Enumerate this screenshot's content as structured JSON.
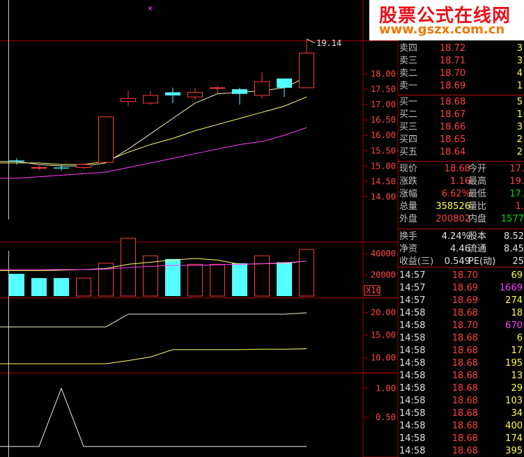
{
  "logo": {
    "line1": "股票公式在线网",
    "line2": "www.gszx.com.cn"
  },
  "price_chart": {
    "high_marker": "19.14",
    "y_ticks": [
      "18.00",
      "17.50",
      "17.00",
      "16.50",
      "16.00",
      "15.50",
      "15.00",
      "14.50",
      "14.00"
    ],
    "ylim": [
      13.6,
      19.5
    ],
    "candles": [
      {
        "o": 15.15,
        "c": 15.18,
        "h": 15.25,
        "l": 15.05,
        "up": false
      },
      {
        "o": 14.95,
        "c": 14.95,
        "h": 15.05,
        "l": 14.85,
        "up": true
      },
      {
        "o": 14.92,
        "c": 14.95,
        "h": 15.05,
        "l": 14.85,
        "up": false
      },
      {
        "o": 14.95,
        "c": 15.05,
        "h": 15.1,
        "l": 14.9,
        "up": true
      },
      {
        "o": 15.12,
        "c": 16.6,
        "h": 16.6,
        "l": 15.12,
        "up": true
      },
      {
        "o": 17.1,
        "c": 17.2,
        "h": 17.45,
        "l": 16.95,
        "up": true
      },
      {
        "o": 17.05,
        "c": 17.3,
        "h": 17.45,
        "l": 17.0,
        "up": true
      },
      {
        "o": 17.4,
        "c": 17.3,
        "h": 17.55,
        "l": 17.05,
        "up": false
      },
      {
        "o": 17.25,
        "c": 17.4,
        "h": 17.55,
        "l": 17.15,
        "up": true
      },
      {
        "o": 17.55,
        "c": 17.55,
        "h": 17.62,
        "l": 17.35,
        "up": true
      },
      {
        "o": 17.5,
        "c": 17.35,
        "h": 17.55,
        "l": 17.0,
        "up": false
      },
      {
        "o": 17.3,
        "c": 17.75,
        "h": 18.05,
        "l": 17.2,
        "up": true
      },
      {
        "o": 17.85,
        "c": 17.55,
        "h": 17.85,
        "l": 17.25,
        "up": false
      },
      {
        "o": 17.55,
        "c": 18.68,
        "h": 19.14,
        "l": 17.55,
        "up": true
      }
    ],
    "ma_short": [
      15.15,
      15.05,
      15.0,
      15.0,
      15.1,
      15.55,
      16.05,
      16.55,
      17.05,
      17.35,
      17.4,
      17.45,
      17.55,
      17.9
    ],
    "ma_mid": [
      15.1,
      15.1,
      15.05,
      15.05,
      15.15,
      15.45,
      15.7,
      15.9,
      16.15,
      16.35,
      16.55,
      16.75,
      16.95,
      17.25
    ],
    "ma_long": [
      14.6,
      14.65,
      14.7,
      14.75,
      14.8,
      14.95,
      15.1,
      15.25,
      15.4,
      15.55,
      15.7,
      15.8,
      16.0,
      16.25
    ]
  },
  "volume_chart": {
    "y_ticks": [
      "40000",
      "20000"
    ],
    "factor": "X10",
    "ymax": 48000,
    "bars": [
      {
        "v": 21000,
        "up": false
      },
      {
        "v": 17000,
        "up": false
      },
      {
        "v": 17000,
        "up": false
      },
      {
        "v": 17000,
        "up": true
      },
      {
        "v": 31000,
        "up": true
      },
      {
        "v": 60000,
        "up": true
      },
      {
        "v": 38000,
        "up": true
      },
      {
        "v": 35000,
        "up": false
      },
      {
        "v": 30000,
        "up": true
      },
      {
        "v": 30000,
        "up": true
      },
      {
        "v": 31000,
        "up": false
      },
      {
        "v": 38000,
        "up": true
      },
      {
        "v": 32000,
        "up": false
      },
      {
        "v": 44000,
        "up": true
      }
    ],
    "ma1": [
      24000,
      24000,
      24500,
      25000,
      26000,
      30000,
      32000,
      34000,
      35500,
      34000,
      30000,
      30500,
      31000,
      33000
    ],
    "ma2": [
      25000,
      25000,
      25000,
      25000,
      25500,
      27000,
      28000,
      29000,
      29000,
      29500,
      30000,
      30500,
      31500,
      33000
    ]
  },
  "indicator1": {
    "y_ticks": [
      "20.00",
      "15.00",
      "10.00"
    ],
    "ylim": [
      7.5,
      22.5
    ],
    "line1": [
      16.8,
      16.8,
      16.8,
      16.8,
      16.8,
      19.6,
      19.6,
      19.6,
      19.6,
      19.6,
      19.6,
      19.6,
      19.6,
      19.9
    ],
    "line2": [
      8.7,
      8.7,
      8.7,
      8.7,
      8.7,
      9.4,
      10.2,
      11.8,
      11.8,
      11.8,
      11.8,
      11.9,
      11.9,
      12.0
    ]
  },
  "indicator2": {
    "y_ticks": [
      "1.00",
      "0.50"
    ],
    "ylim": [
      -0.05,
      1.15
    ],
    "line": [
      0,
      0,
      1,
      0,
      0,
      0,
      0,
      0,
      0,
      0,
      0,
      0,
      0,
      0
    ]
  },
  "quote": {
    "asks": [
      {
        "label": "卖四",
        "price": "18.72",
        "qty": "3"
      },
      {
        "label": "卖三",
        "price": "18.71",
        "qty": "3"
      },
      {
        "label": "卖二",
        "price": "18.70",
        "qty": "4"
      },
      {
        "label": "卖一",
        "price": "18.69",
        "qty": "1"
      }
    ],
    "bids": [
      {
        "label": "买一",
        "price": "18.68",
        "qty": "5"
      },
      {
        "label": "买二",
        "price": "18.67",
        "qty": "1"
      },
      {
        "label": "买三",
        "price": "18.66",
        "qty": "3"
      },
      {
        "label": "买四",
        "price": "18.65",
        "qty": "2"
      },
      {
        "label": "买五",
        "price": "18.64",
        "qty": "2"
      }
    ],
    "stats": [
      {
        "l1": "现价",
        "v1": "18.68",
        "c1": "red",
        "l2": "今开",
        "v2": "17.",
        "c2": "red"
      },
      {
        "l1": "涨跌",
        "v1": "1.16",
        "c1": "red",
        "l2": "最高",
        "v2": "19.",
        "c2": "red"
      },
      {
        "l1": "涨幅",
        "v1": "6.62%",
        "c1": "red",
        "l2": "最低",
        "v2": "17.",
        "c2": "grn"
      },
      {
        "l1": "总量",
        "v1": "358526",
        "c1": "yel",
        "l2": "量比",
        "v2": "1.",
        "c2": "red"
      },
      {
        "l1": "外盘",
        "v1": "200802",
        "c1": "red",
        "l2": "内盘",
        "v2": "1577",
        "c2": "grn"
      }
    ],
    "fin": [
      {
        "l1": "换手",
        "v1": "4.24%",
        "l2": "股本",
        "v2": "8.52"
      },
      {
        "l1": "净资",
        "v1": "4.46",
        "l2": "流通",
        "v2": "8.45"
      },
      {
        "l1": "收益(三)",
        "v1": "0.549",
        "l2": "PE(动)",
        "v2": "25"
      }
    ],
    "ticks": [
      {
        "t": "14:57",
        "p": "18.70",
        "v": "69",
        "c": "yel"
      },
      {
        "t": "14:57",
        "p": "18.69",
        "v": "1669",
        "c": "mag"
      },
      {
        "t": "14:57",
        "p": "18.69",
        "v": "274",
        "c": "yel"
      },
      {
        "t": "14:58",
        "p": "18.68",
        "v": "18",
        "c": "yel"
      },
      {
        "t": "14:58",
        "p": "18.70",
        "v": "670",
        "c": "mag"
      },
      {
        "t": "14:58",
        "p": "18.68",
        "v": "6",
        "c": "yel"
      },
      {
        "t": "14:58",
        "p": "18.68",
        "v": "17",
        "c": "yel"
      },
      {
        "t": "14:58",
        "p": "18.68",
        "v": "195",
        "c": "yel"
      },
      {
        "t": "14:58",
        "p": "18.68",
        "v": "13",
        "c": "yel"
      },
      {
        "t": "14:58",
        "p": "18.68",
        "v": "29",
        "c": "yel"
      },
      {
        "t": "14:58",
        "p": "18.68",
        "v": "103",
        "c": "yel"
      },
      {
        "t": "14:58",
        "p": "18.68",
        "v": "34",
        "c": "yel"
      },
      {
        "t": "14:58",
        "p": "18.68",
        "v": "400",
        "c": "yel"
      },
      {
        "t": "14:58",
        "p": "18.68",
        "v": "174",
        "c": "yel"
      },
      {
        "t": "14:58",
        "p": "18.68",
        "v": "395",
        "c": "yel"
      }
    ]
  },
  "colors": {
    "up": "#ff3c3c",
    "down": "#54ffff",
    "ma_white": "#ffffff",
    "ma_yellow": "#ffff66",
    "ma_magenta": "#ff40ff",
    "grid": "#a00000"
  }
}
